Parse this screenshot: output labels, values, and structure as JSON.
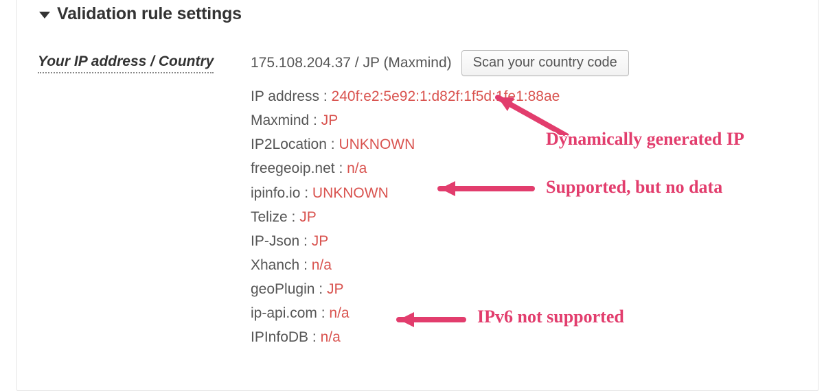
{
  "section": {
    "title": "Validation rule settings"
  },
  "row": {
    "label": "Your IP address / Country",
    "summary": "175.108.204.37 / JP (Maxmind)",
    "scan_button": "Scan your country code"
  },
  "details": [
    {
      "label": "IP address",
      "value": "240f:e2:5e92:1:d82f:1f5d:1fe1:88ae"
    },
    {
      "label": "Maxmind",
      "value": "JP"
    },
    {
      "label": "IP2Location",
      "value": "UNKNOWN"
    },
    {
      "label": "freegeoip.net",
      "value": "n/a"
    },
    {
      "label": "ipinfo.io",
      "value": "UNKNOWN"
    },
    {
      "label": "Telize",
      "value": "JP"
    },
    {
      "label": "IP-Json",
      "value": "JP"
    },
    {
      "label": "Xhanch",
      "value": "n/a"
    },
    {
      "label": "geoPlugin",
      "value": "JP"
    },
    {
      "label": "ip-api.com",
      "value": "n/a"
    },
    {
      "label": "IPInfoDB",
      "value": "n/a"
    }
  ],
  "annotations": {
    "dyn_ip": "Dynamically generated IP",
    "supported": "Supported, but no data",
    "ipv6": "IPv6 not supported"
  }
}
